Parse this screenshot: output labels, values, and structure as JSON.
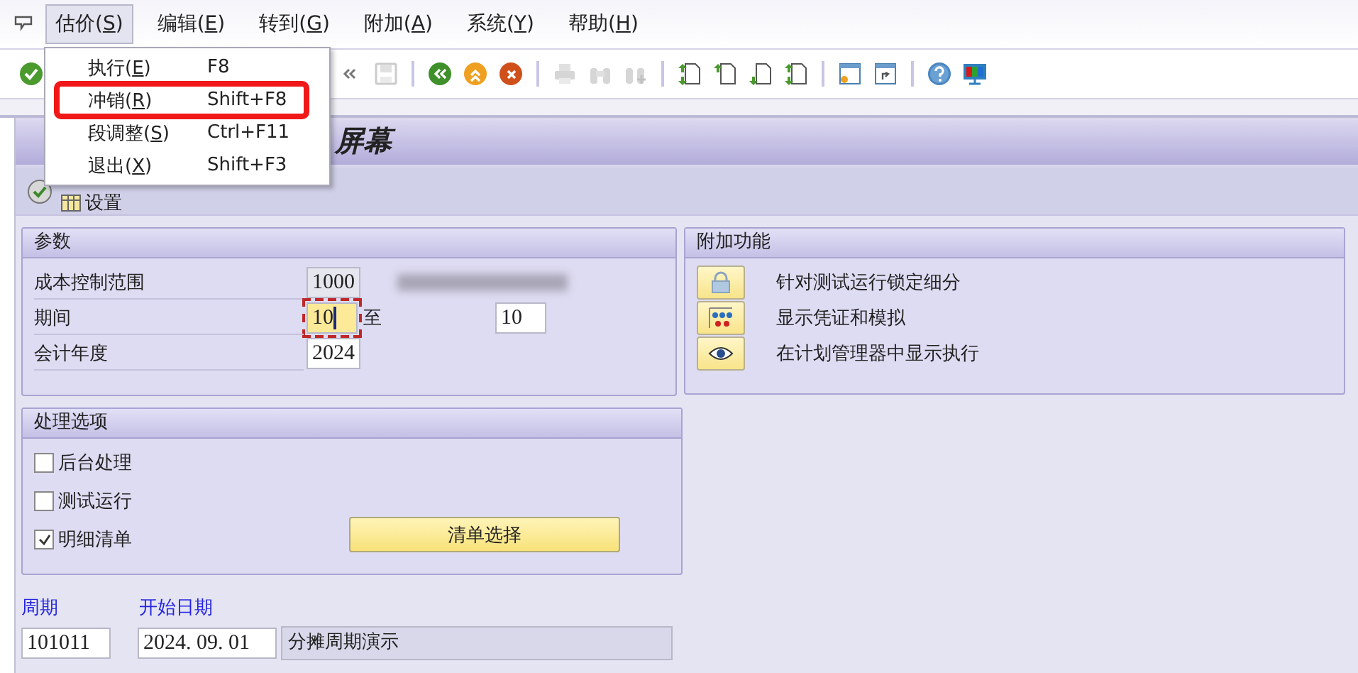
{
  "menu_bar": [
    {
      "before": "估价(",
      "hotkey": "S",
      "after": ")",
      "selected": true
    },
    {
      "before": "编辑(",
      "hotkey": "E",
      "after": ")",
      "selected": false
    },
    {
      "before": "转到(",
      "hotkey": "G",
      "after": ")",
      "selected": false
    },
    {
      "before": "附加(",
      "hotkey": "A",
      "after": ")",
      "selected": false
    },
    {
      "before": "系统(",
      "hotkey": "Y",
      "after": ")",
      "selected": false
    },
    {
      "before": "帮助(",
      "hotkey": "H",
      "after": ")",
      "selected": false
    }
  ],
  "open_menu": {
    "items": [
      {
        "before": "执行(",
        "hotkey": "E",
        "after": ")",
        "shortcut": "F8",
        "highlighted": false
      },
      {
        "before": "冲销(",
        "hotkey": "R",
        "after": ")",
        "shortcut": "Shift+F8",
        "highlighted": true
      },
      {
        "before": "段调整(",
        "hotkey": "S",
        "after": ")",
        "shortcut": "Ctrl+F11",
        "highlighted": false
      },
      {
        "before": "退出(",
        "hotkey": "X",
        "after": ")",
        "shortcut": "Shift+F3",
        "highlighted": false
      }
    ]
  },
  "toolbar": [
    {
      "kind": "check",
      "disabled": false
    },
    {
      "kind": "gap"
    },
    {
      "kind": "chevrons",
      "disabled": false
    },
    {
      "kind": "save",
      "disabled": true
    },
    {
      "kind": "separator"
    },
    {
      "kind": "back",
      "disabled": false
    },
    {
      "kind": "exit",
      "disabled": false
    },
    {
      "kind": "cancel",
      "disabled": false
    },
    {
      "kind": "separator"
    },
    {
      "kind": "print",
      "disabled": true
    },
    {
      "kind": "find",
      "disabled": true
    },
    {
      "kind": "find-next",
      "disabled": true
    },
    {
      "kind": "separator"
    },
    {
      "kind": "first-page",
      "disabled": false
    },
    {
      "kind": "prev-page",
      "disabled": false
    },
    {
      "kind": "next-page",
      "disabled": false
    },
    {
      "kind": "last-page",
      "disabled": false
    },
    {
      "kind": "separator"
    },
    {
      "kind": "new-session",
      "disabled": false
    },
    {
      "kind": "shortcut",
      "disabled": false
    },
    {
      "kind": "separator"
    },
    {
      "kind": "help",
      "disabled": false
    },
    {
      "kind": "layout",
      "disabled": false
    }
  ],
  "title": "屏幕",
  "app_toolbar": {
    "button": "设置"
  },
  "parameters": {
    "title": "参数",
    "rows": [
      {
        "label": "成本控制范围",
        "value": "1000",
        "readonly": true,
        "focused": false,
        "redacted": true
      },
      {
        "label": "期间",
        "value": "10",
        "readonly": false,
        "focused": true,
        "to_label": "至",
        "to_value": "10"
      },
      {
        "label": "会计年度",
        "value": "2024",
        "readonly": false,
        "focused": false
      }
    ]
  },
  "extras": {
    "title": "附加功能",
    "items": [
      {
        "kind": "lock",
        "label": "针对测试运行锁定细分"
      },
      {
        "kind": "tree",
        "label": "显示凭证和模拟"
      },
      {
        "kind": "eye",
        "label": "在计划管理器中显示执行"
      }
    ]
  },
  "processing": {
    "title": "处理选项",
    "options": [
      {
        "label": "后台处理",
        "checked": false
      },
      {
        "label": "测试运行",
        "checked": false
      },
      {
        "label": "明细清单",
        "checked": true
      }
    ],
    "button": "清单选择"
  },
  "cycles": {
    "columns": [
      "周期",
      "开始日期"
    ],
    "rows": [
      {
        "cycle": "101011",
        "start": "2024. 09. 01",
        "description": "分摊周期演示"
      }
    ]
  }
}
